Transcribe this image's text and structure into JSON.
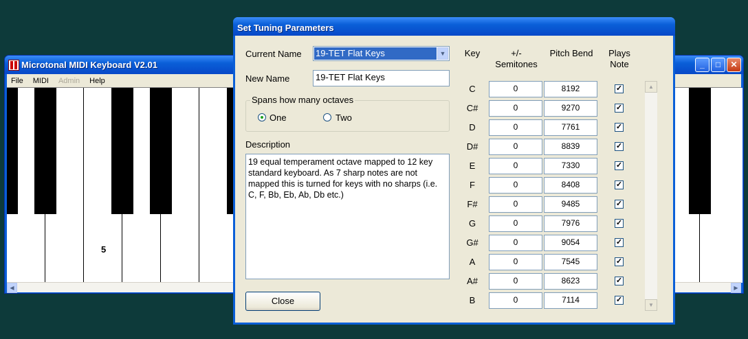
{
  "main_window": {
    "title": "Microtonal MIDI Keyboard V2.01",
    "menu": [
      "File",
      "MIDI",
      "Admin",
      "Help"
    ],
    "key_label": "5",
    "controls": {
      "minimize": "_",
      "maximize": "□",
      "close": "✕"
    }
  },
  "dialog": {
    "title": "Set Tuning Parameters",
    "current_name_label": "Current Name",
    "current_name_value": "19-TET Flat Keys",
    "new_name_label": "New Name",
    "new_name_value": "19-TET Flat Keys",
    "octaves_group_label": "Spans how many octaves",
    "octave_options": [
      {
        "label": "One",
        "checked": true
      },
      {
        "label": "Two",
        "checked": false
      }
    ],
    "description_label": "Description",
    "description_text": "19 equal temperament octave mapped to 12 key standard keyboard. As 7 sharp notes are not mapped this is turned for keys with no sharps (i.e. C, F, Bb, Eb, Ab, Db etc.)",
    "close_button": "Close",
    "table_headers": {
      "key": "Key",
      "semitones_line1": "+/-",
      "semitones_line2": "Semitones",
      "pitch_bend": "Pitch Bend",
      "plays_line1": "Plays",
      "plays_line2": "Note"
    },
    "notes": [
      {
        "key": "C",
        "semitones": "0",
        "pitch_bend": "8192",
        "plays": true
      },
      {
        "key": "C#",
        "semitones": "0",
        "pitch_bend": "9270",
        "plays": true
      },
      {
        "key": "D",
        "semitones": "0",
        "pitch_bend": "7761",
        "plays": true
      },
      {
        "key": "D#",
        "semitones": "0",
        "pitch_bend": "8839",
        "plays": true
      },
      {
        "key": "E",
        "semitones": "0",
        "pitch_bend": "7330",
        "plays": true
      },
      {
        "key": "F",
        "semitones": "0",
        "pitch_bend": "8408",
        "plays": true
      },
      {
        "key": "F#",
        "semitones": "0",
        "pitch_bend": "9485",
        "plays": true
      },
      {
        "key": "G",
        "semitones": "0",
        "pitch_bend": "7976",
        "plays": true
      },
      {
        "key": "G#",
        "semitones": "0",
        "pitch_bend": "9054",
        "plays": true
      },
      {
        "key": "A",
        "semitones": "0",
        "pitch_bend": "7545",
        "plays": true
      },
      {
        "key": "A#",
        "semitones": "0",
        "pitch_bend": "8623",
        "plays": true
      },
      {
        "key": "B",
        "semitones": "0",
        "pitch_bend": "7114",
        "plays": true
      }
    ]
  }
}
